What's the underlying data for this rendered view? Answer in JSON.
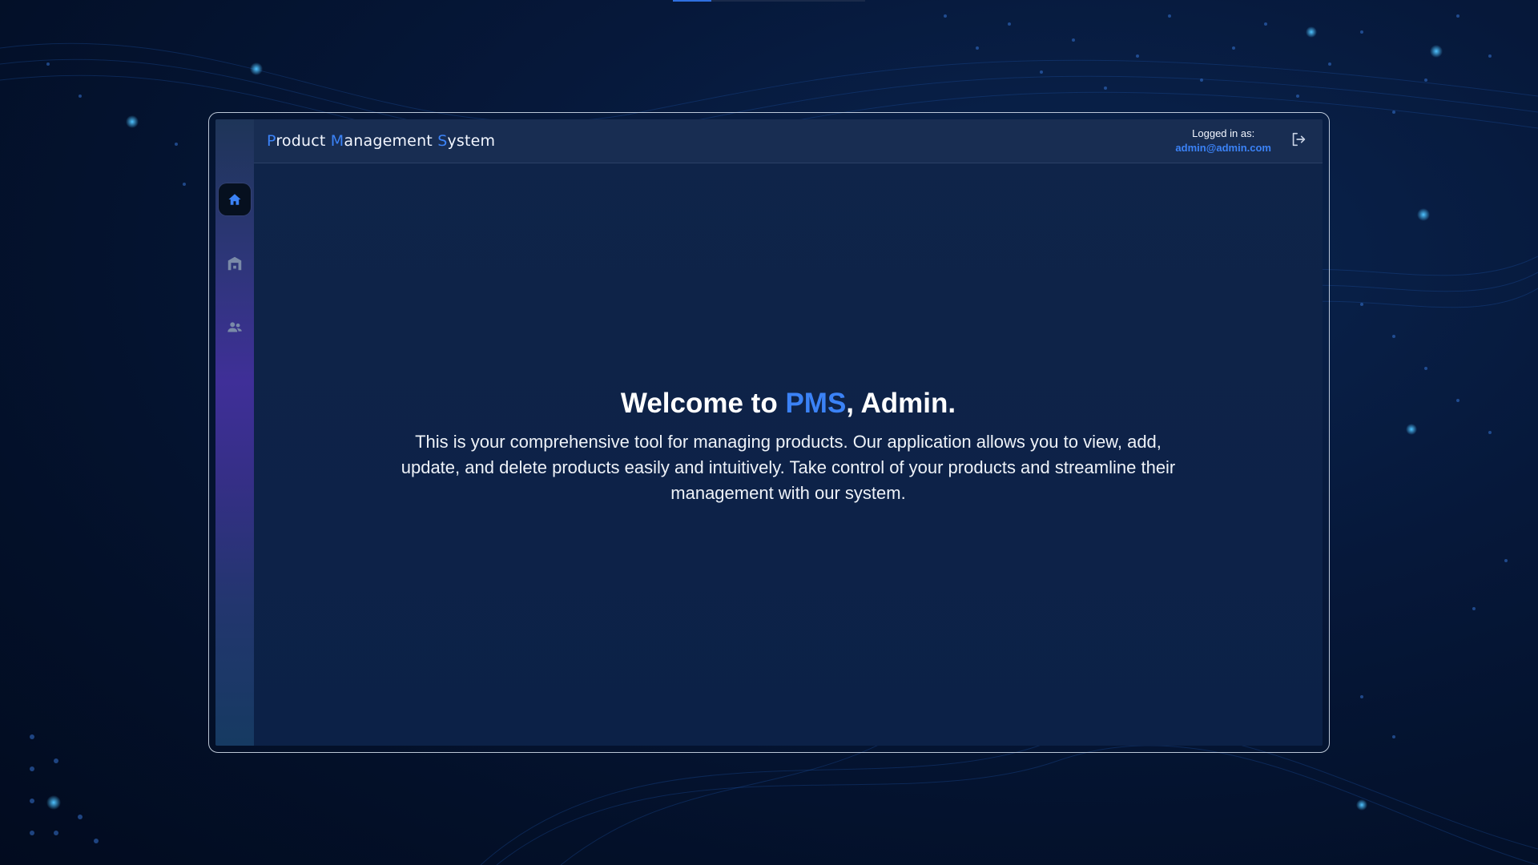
{
  "header": {
    "title_parts": [
      {
        "text": "P",
        "hl": true
      },
      {
        "text": "roduct ",
        "hl": false
      },
      {
        "text": "M",
        "hl": true
      },
      {
        "text": "anagement ",
        "hl": false
      },
      {
        "text": "S",
        "hl": true
      },
      {
        "text": "ystem",
        "hl": false
      }
    ],
    "logged_in_label": "Logged in as:",
    "user_email": "admin@admin.com",
    "logout_icon": "logout-icon"
  },
  "sidebar": {
    "items": [
      {
        "icon": "home-icon",
        "active": true
      },
      {
        "icon": "warehouse-icon",
        "active": false
      },
      {
        "icon": "users-icon",
        "active": false
      }
    ]
  },
  "main": {
    "heading_prefix": "Welcome to ",
    "heading_brand": "PMS",
    "heading_suffix": ", Admin.",
    "description": "This is your comprehensive tool for managing products. Our application allows you to view, add, update, and delete products easily and intuitively. Take control of your products and streamline their management with our system."
  },
  "colors": {
    "accent": "#3b82f6",
    "background": "#031029",
    "panel": "#0d2248",
    "topbar": "#182d52"
  }
}
